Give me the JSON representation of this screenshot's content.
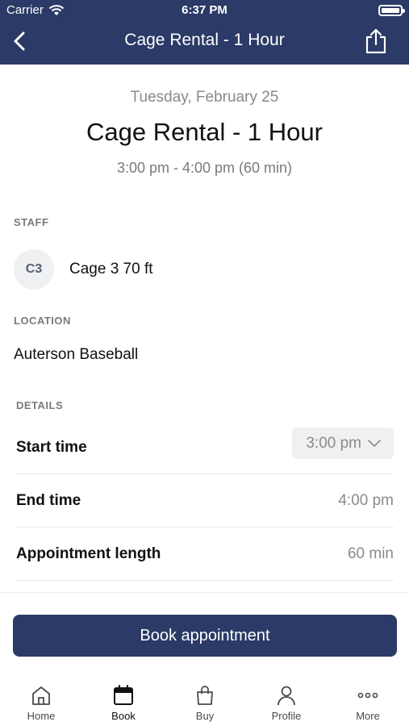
{
  "status_bar": {
    "carrier": "Carrier",
    "time": "6:37 PM"
  },
  "nav": {
    "title": "Cage Rental - 1 Hour",
    "back_icon": "chevron-left-icon",
    "share_icon": "share-icon"
  },
  "summary": {
    "date": "Tuesday, February 25",
    "title": "Cage Rental - 1 Hour",
    "time_range": "3:00 pm - 4:00 pm (60 min)"
  },
  "staff": {
    "label": "STAFF",
    "initials": "C3",
    "name": "Cage 3 70 ft"
  },
  "location": {
    "label": "LOCATION",
    "name": "Auterson Baseball"
  },
  "details": {
    "label": "DETAILS",
    "start_time": {
      "label": "Start time",
      "value": "3:00 pm"
    },
    "end_time": {
      "label": "End time",
      "value": "4:00 pm"
    },
    "length": {
      "label": "Appointment length",
      "value": "60 min"
    }
  },
  "book_button": "Book appointment",
  "tabs": [
    {
      "label": "Home",
      "icon": "home-icon",
      "active": false
    },
    {
      "label": "Book",
      "icon": "calendar-icon",
      "active": true
    },
    {
      "label": "Buy",
      "icon": "shopping-bag-icon",
      "active": false
    },
    {
      "label": "Profile",
      "icon": "person-icon",
      "active": false
    },
    {
      "label": "More",
      "icon": "more-icon",
      "active": false
    }
  ],
  "colors": {
    "brand": "#2b3a66",
    "muted_text": "#8a8a8a",
    "select_bg": "#eef0f2"
  }
}
